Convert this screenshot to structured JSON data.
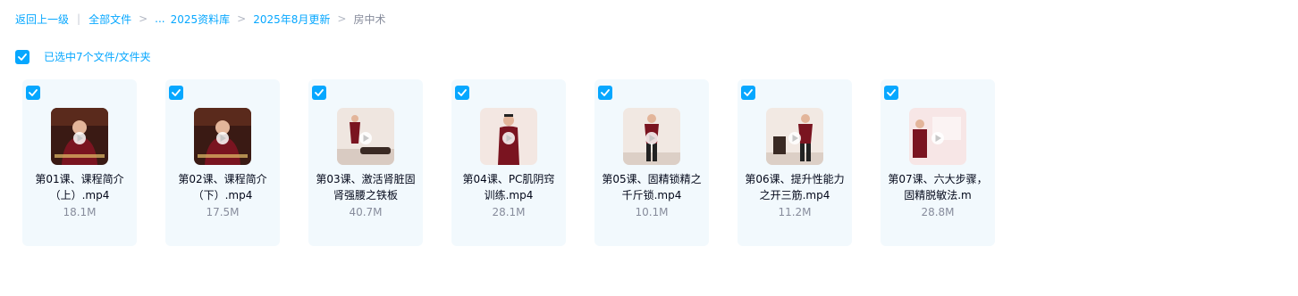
{
  "colors": {
    "accent": "#06a7ff",
    "card_bg": "#f2f9fd",
    "text": "#03081a",
    "muted": "#878c9c"
  },
  "breadcrumb": {
    "back": "返回上一级",
    "all_files": "全部文件",
    "ellipsis": "...",
    "crumb1": "2025资料库",
    "crumb2": "2025年8月更新",
    "current": "房中术"
  },
  "selection": {
    "label": "已选中7个文件/文件夹",
    "checked": true
  },
  "files": [
    {
      "name": "第01课、课程简介（上）.mp4",
      "size": "18.1M",
      "checked": true,
      "icon": "video-thumbnail"
    },
    {
      "name": "第02课、课程简介（下）.mp4",
      "size": "17.5M",
      "checked": true,
      "icon": "video-thumbnail"
    },
    {
      "name": "第03课、激活肾脏固肾强腰之铁板",
      "size": "40.7M",
      "checked": true,
      "icon": "video-thumbnail"
    },
    {
      "name": "第04课、PC肌阴窍训练.mp4",
      "size": "28.1M",
      "checked": true,
      "icon": "video-thumbnail"
    },
    {
      "name": "第05课、固精锁精之千斤锁.mp4",
      "size": "10.1M",
      "checked": true,
      "icon": "video-thumbnail"
    },
    {
      "name": "第06课、提升性能力之开三筋.mp4",
      "size": "11.2M",
      "checked": true,
      "icon": "video-thumbnail"
    },
    {
      "name": "第07课、六大步骤，固精脱敏法.m",
      "size": "28.8M",
      "checked": true,
      "icon": "video-thumbnail"
    }
  ]
}
